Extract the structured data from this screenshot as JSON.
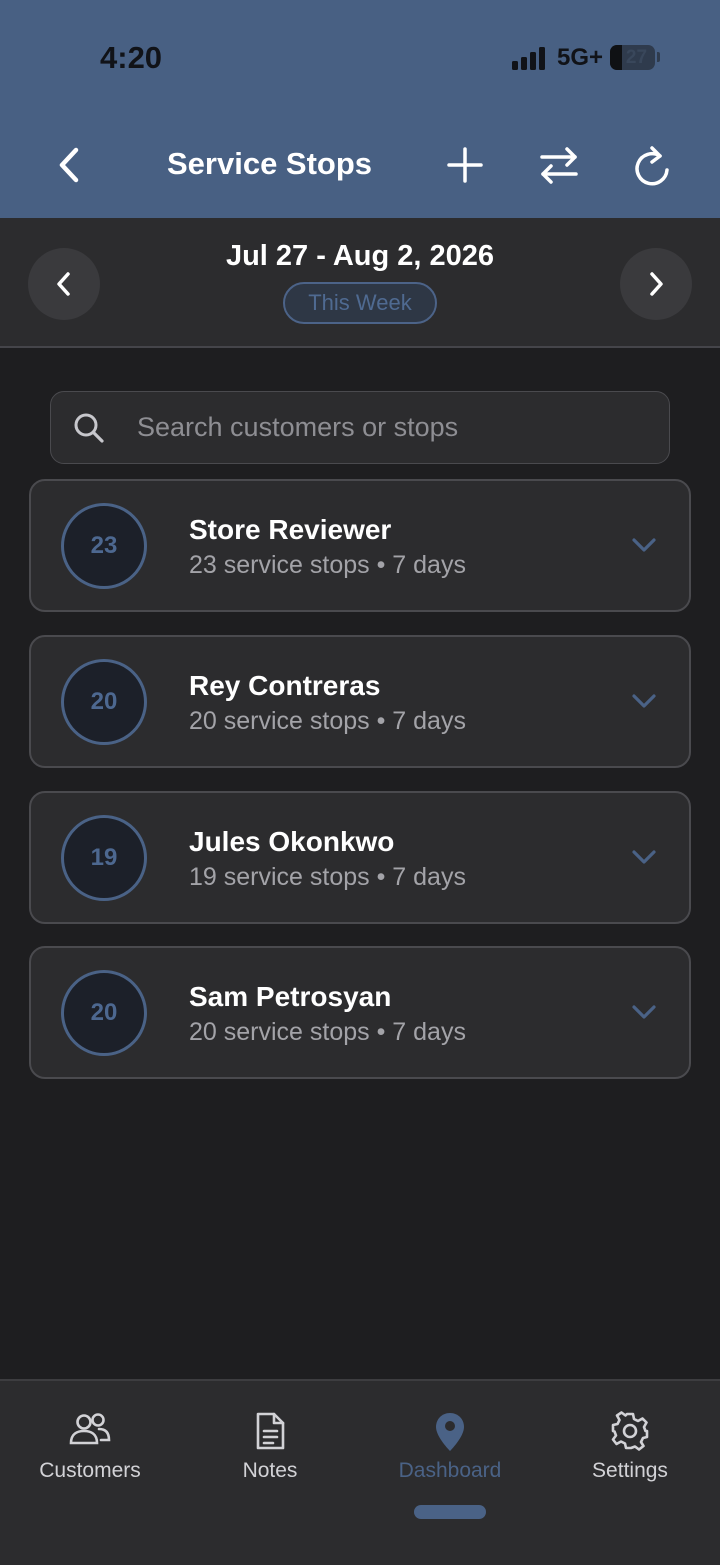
{
  "status_bar": {
    "time": "4:20",
    "network": "5G+",
    "battery_level": "27",
    "battery_fraction": 0.27
  },
  "header": {
    "title": "Service Stops",
    "icons": [
      "back-chevron-icon",
      "plus-icon",
      "swap-arrows-icon",
      "refresh-icon"
    ],
    "accent_color": "#486083"
  },
  "week": {
    "range": "Jul 27 - Aug 2, 2026",
    "badge": "This Week"
  },
  "search": {
    "placeholder": "Search customers or stops",
    "value": ""
  },
  "customers": [
    {
      "count": "23",
      "name": "Store Reviewer",
      "summary": "23 service stops • 7 days"
    },
    {
      "count": "20",
      "name": "Rey Contreras",
      "summary": "20 service stops • 7 days"
    },
    {
      "count": "19",
      "name": "Jules Okonkwo",
      "summary": "19 service stops • 7 days"
    },
    {
      "count": "20",
      "name": "Sam Petrosyan",
      "summary": "20 service stops • 7 days"
    }
  ],
  "tabs": [
    {
      "label": "Customers",
      "icon": "people-icon",
      "active": false
    },
    {
      "label": "Notes",
      "icon": "document-icon",
      "active": false
    },
    {
      "label": "Dashboard",
      "icon": "location-pin-icon",
      "active": true
    },
    {
      "label": "Settings",
      "icon": "gear-icon",
      "active": false
    }
  ]
}
